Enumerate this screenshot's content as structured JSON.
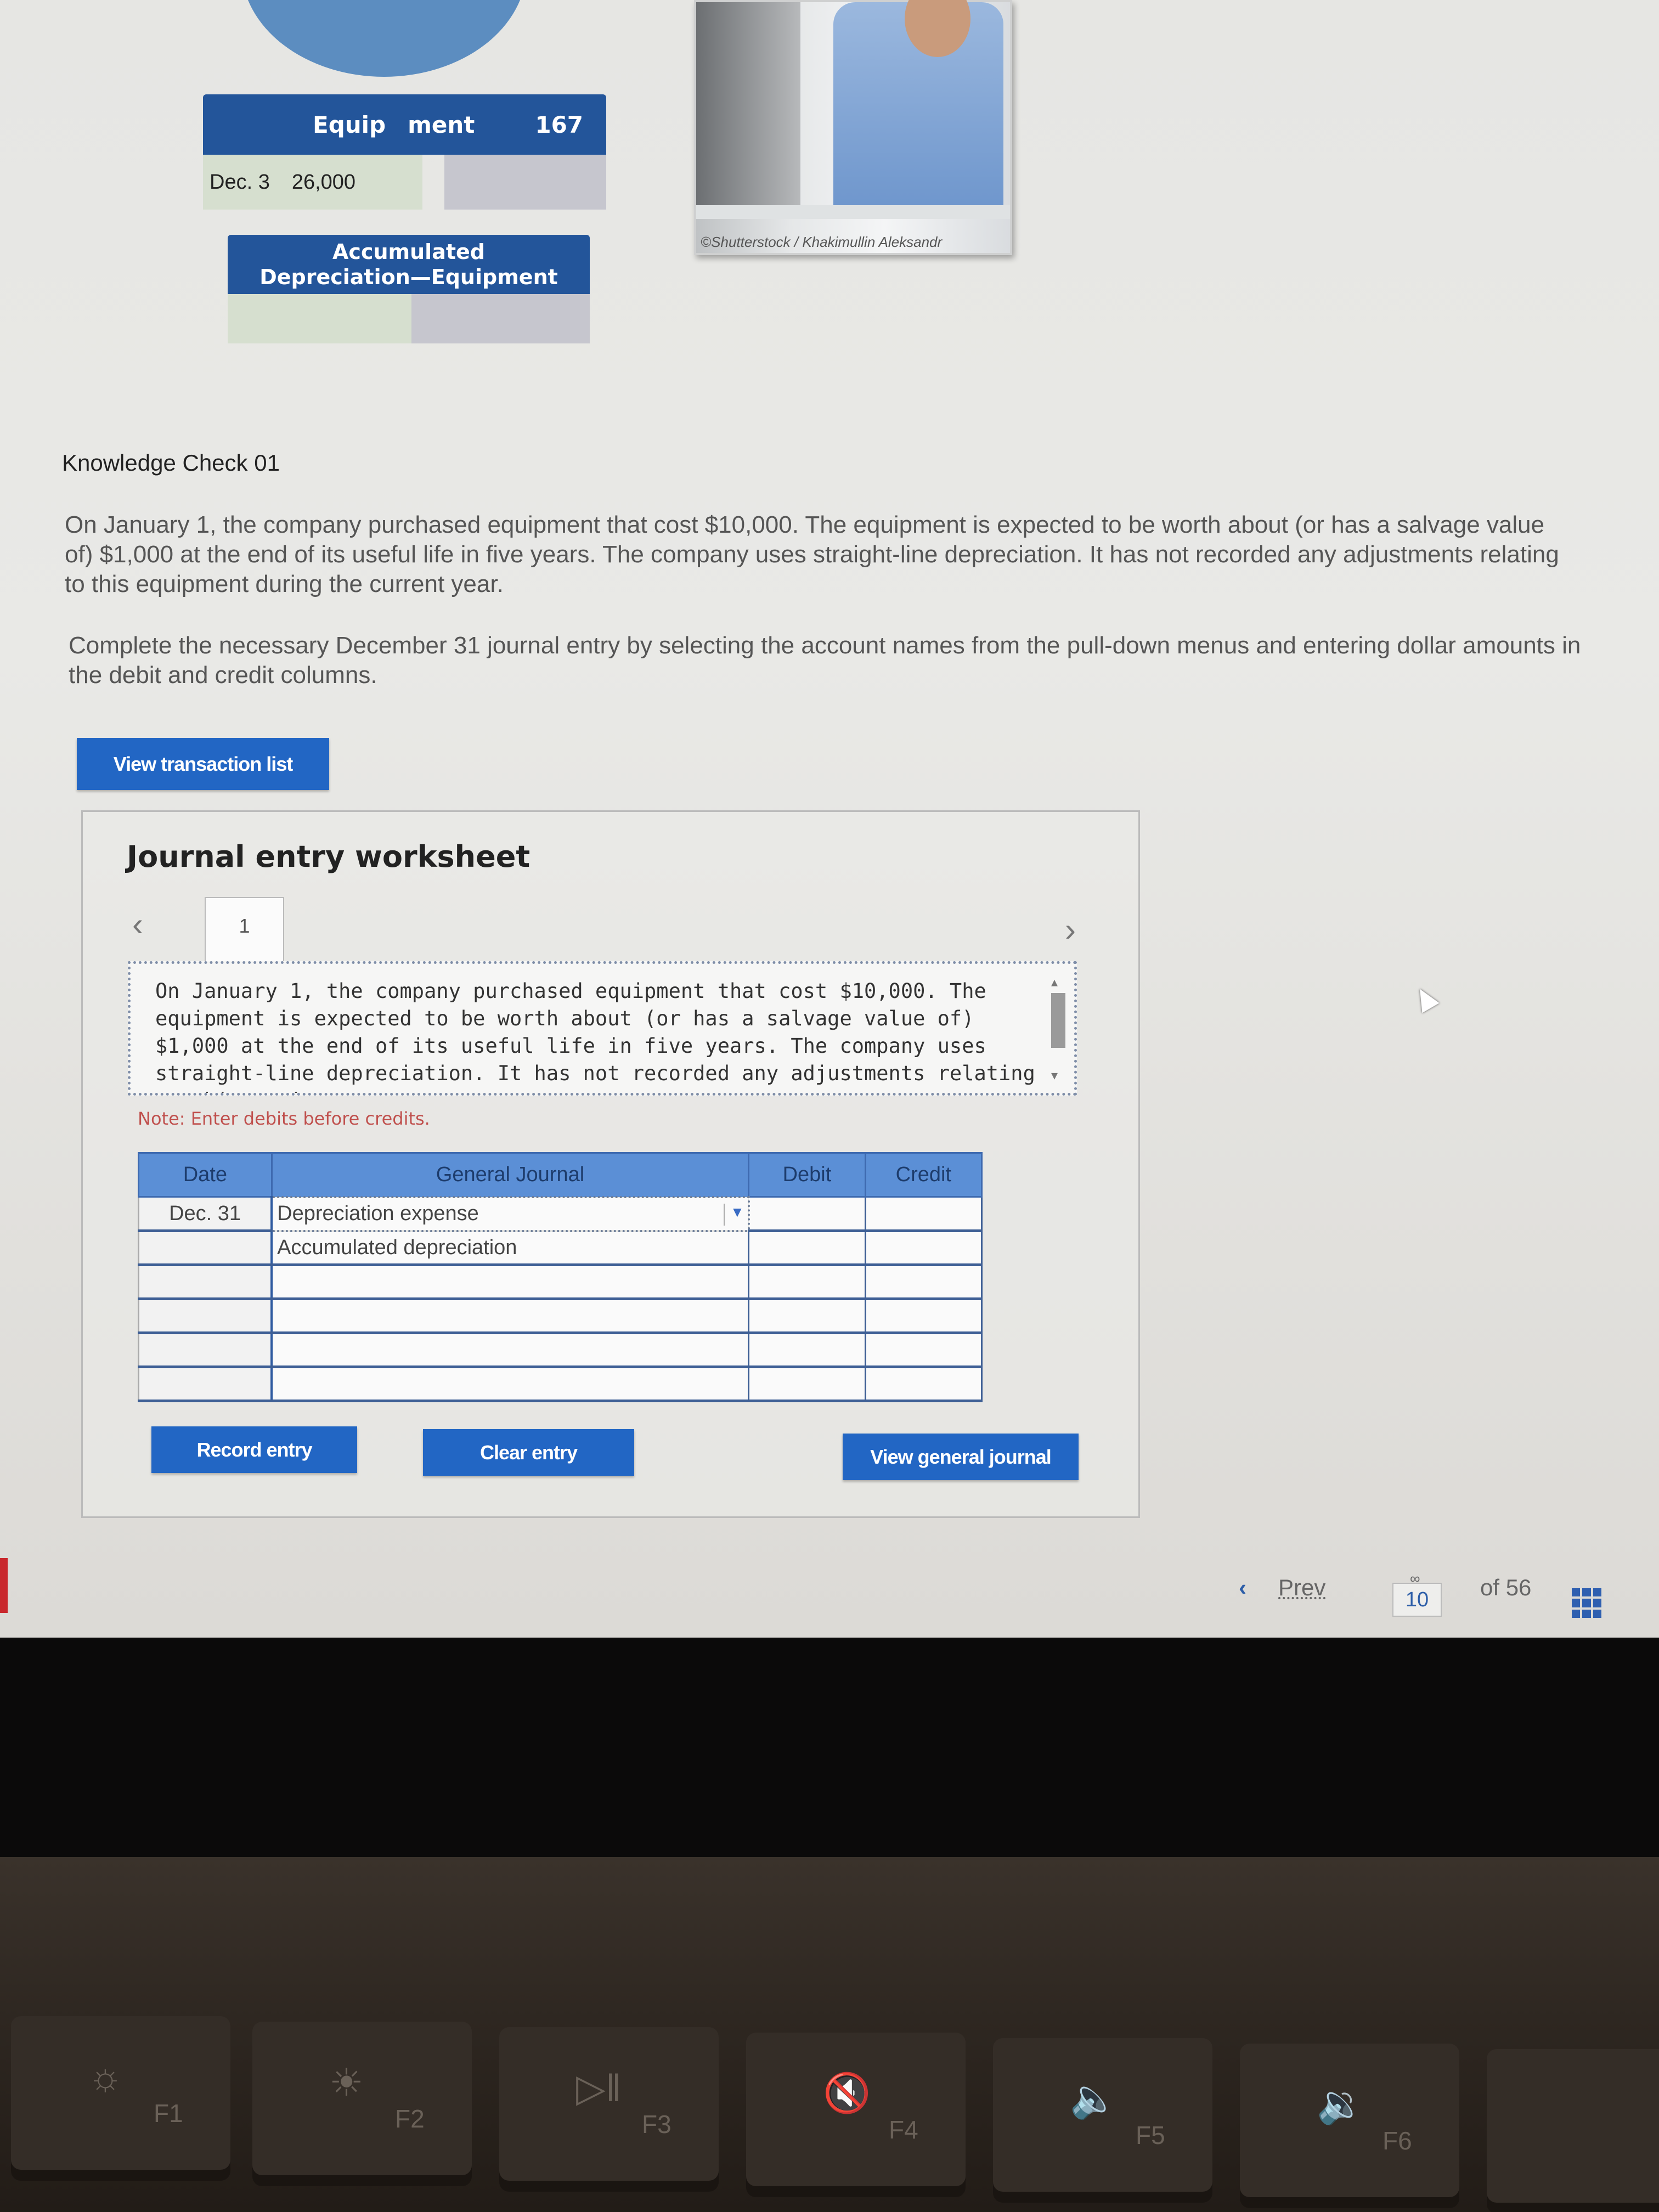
{
  "illustration": {
    "equipment_account": {
      "title_left": "Equip",
      "title_right": "ment",
      "number": "167",
      "entry_date": "Dec. 3",
      "entry_amount": "26,000"
    },
    "accum_account": {
      "title_line1": "Accumulated",
      "title_line2": "Depreciation—Equipment"
    },
    "photo_credit": "©Shutterstock / Khakimullin Aleksandr"
  },
  "question": {
    "title": "Knowledge Check 01",
    "paragraph1": "On January 1, the company purchased equipment that cost $10,000. The equipment is expected to be worth about (or has a salvage value of) $1,000 at the end of its useful life in five years. The company uses straight-line depreciation. It has not recorded any adjustments relating to this equipment during the current year.",
    "paragraph2": "Complete the necessary December 31 journal entry by selecting the account names from the pull-down menus and entering dollar amounts in the debit and credit columns."
  },
  "buttons": {
    "view_transaction_list": "View transaction list",
    "record_entry": "Record entry",
    "clear_entry": "Clear entry",
    "view_general_journal": "View general journal"
  },
  "worksheet": {
    "title": "Journal entry worksheet",
    "prev_icon": "‹",
    "next_icon": "›",
    "tab_label": "1",
    "description": "On January 1, the company purchased equipment that cost $10,000. The equipment is expected to be worth about (or has a salvage value of) $1,000 at the end of its useful life in five years. The company uses straight-line depreciation. It has not recorded any adjustments relating to this equipment",
    "note": "Note: Enter debits before credits.",
    "table": {
      "headers": [
        "Date",
        "General Journal",
        "Debit",
        "Credit"
      ],
      "rows": [
        {
          "date": "Dec. 31",
          "account": "Depreciation expense",
          "debit": "",
          "credit": ""
        },
        {
          "date": "",
          "account": "Accumulated depreciation",
          "debit": "",
          "credit": ""
        },
        {
          "date": "",
          "account": "",
          "debit": "",
          "credit": ""
        },
        {
          "date": "",
          "account": "",
          "debit": "",
          "credit": ""
        },
        {
          "date": "",
          "account": "",
          "debit": "",
          "credit": ""
        },
        {
          "date": "",
          "account": "",
          "debit": "",
          "credit": ""
        }
      ]
    }
  },
  "pager": {
    "prev_icon": "‹",
    "prev_label": "Prev",
    "current_page": "10",
    "total_label": "of 56",
    "link_icon": "∞"
  },
  "keyboard": {
    "keys": [
      {
        "label": "F1",
        "icon": "☼"
      },
      {
        "label": "F2",
        "icon": "☀"
      },
      {
        "label": "F3",
        "icon": "▷‖"
      },
      {
        "label": "F4",
        "icon": "🔇"
      },
      {
        "label": "F5",
        "icon": "🔈"
      },
      {
        "label": "F6",
        "icon": "🔉"
      }
    ]
  },
  "colors": {
    "primary_button": "#2266c4",
    "table_header": "#5b8fd6",
    "note_red": "#c0504d",
    "account_header": "#23559a"
  }
}
